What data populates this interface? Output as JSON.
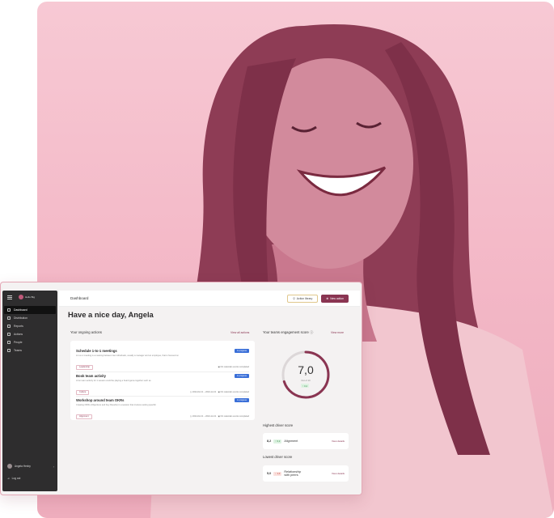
{
  "sidebar": {
    "logo_text": "Hello Big",
    "items": [
      {
        "label": "Dashboard",
        "icon": "grid-icon",
        "active": true
      },
      {
        "label": "Distribution",
        "icon": "heart-icon"
      },
      {
        "label": "Reports",
        "icon": "file-icon"
      },
      {
        "label": "Actions",
        "icon": "bolt-icon"
      },
      {
        "label": "People",
        "icon": "people-icon"
      },
      {
        "label": "Teams",
        "icon": "team-icon"
      }
    ],
    "user_name": "Angela Hexby",
    "logout_label": "Log out"
  },
  "header": {
    "title": "Dashboard",
    "action_library_label": "Action library",
    "new_action_label": "New action"
  },
  "greeting": "Have a nice day, Angela",
  "ongoing": {
    "title": "Your ongoing actions",
    "view_all": "View all actions",
    "items": [
      {
        "title": "Schedule 1-to-1 meetings",
        "desc": "A 1-to-1 meeting is a meeting between two individuals, usually a manager and an employee, that is focused on",
        "badge": "In progress",
        "tag": "Leadership",
        "meta": "0/1 calendar events completed",
        "date": ""
      },
      {
        "title": "Book team activity",
        "desc": "A fun team activity for 1 session could be playing a board game together such as",
        "badge": "In progress",
        "tag": "Culture",
        "meta": "0/1 calendar events completed",
        "date": "2024-02-21 – 2024-12-21"
      },
      {
        "title": "Workshop around team OKRs",
        "desc": "Creating OKRs (Objectives and Key Results) in a session that involves setting specific",
        "badge": "In progress",
        "tag": "Alignment",
        "meta": "0/1 calendar events completed",
        "date": "2024-02-21 – 2024-12-21"
      }
    ]
  },
  "engagement": {
    "title": "Your teams engagement score",
    "view_more": "View more",
    "score": "7,0",
    "score_sub": "Out of 10",
    "delta": "↑ 0,2",
    "fraction": 0.7
  },
  "highest": {
    "title": "Highest driver score",
    "value": "8,2",
    "delta": "↑ 0,2",
    "name": "Alignment",
    "link": "View details"
  },
  "lowest": {
    "title": "Lowest driver score",
    "value": "5,0",
    "delta": "↓ 1,0",
    "name_line1": "Relationship",
    "name_line2": "with peers",
    "link": "View details"
  },
  "colors": {
    "accent": "#8a3552",
    "photo_bg": "#f3b7c6",
    "progress_badge": "#3a6fd8"
  }
}
